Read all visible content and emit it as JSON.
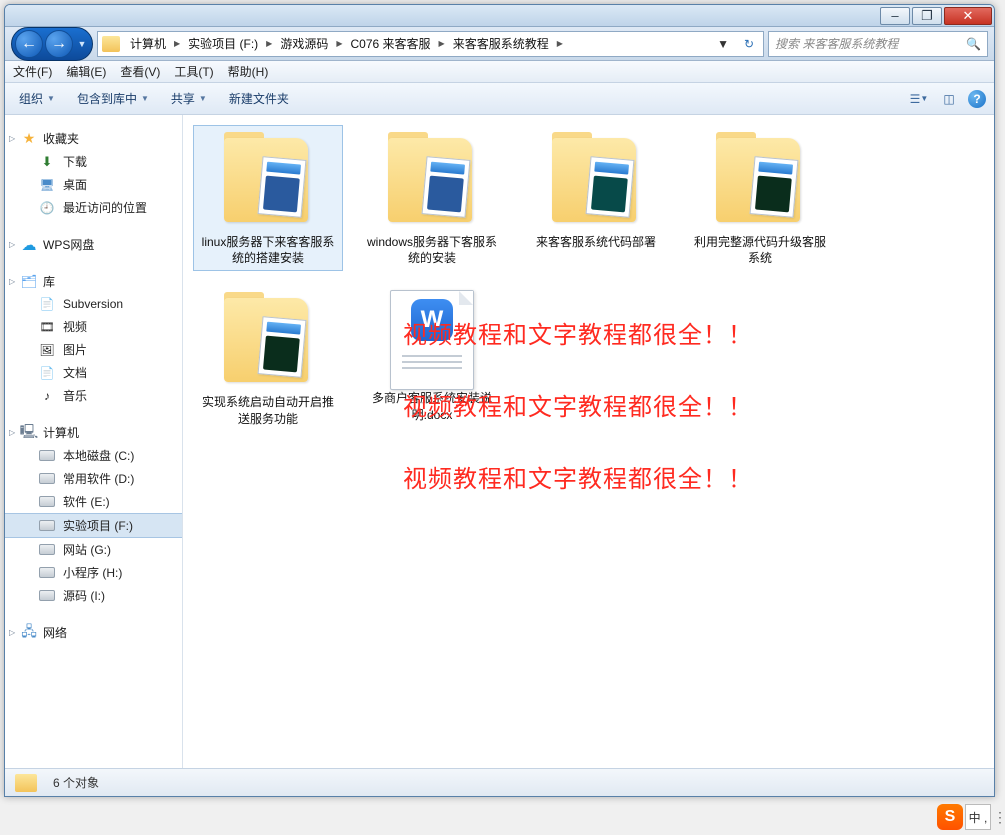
{
  "window": {
    "minimize": "–",
    "maximize": "❐",
    "close": "✕"
  },
  "breadcrumb": [
    "计算机",
    "实验项目 (F:)",
    "游戏源码",
    "C076 来客客服",
    "来客客服系统教程"
  ],
  "search_placeholder": "搜索 来客客服系统教程",
  "menubar": [
    "文件(F)",
    "编辑(E)",
    "查看(V)",
    "工具(T)",
    "帮助(H)"
  ],
  "toolbar": {
    "organize": "组织",
    "include": "包含到库中",
    "share": "共享",
    "newfolder": "新建文件夹"
  },
  "sidebar": {
    "favorites": {
      "title": "收藏夹",
      "items": [
        "下载",
        "桌面",
        "最近访问的位置"
      ]
    },
    "wps": "WPS网盘",
    "library": {
      "title": "库",
      "items": [
        "Subversion",
        "视频",
        "图片",
        "文档",
        "音乐"
      ]
    },
    "computer": {
      "title": "计算机",
      "items": [
        "本地磁盘 (C:)",
        "常用软件 (D:)",
        "软件 (E:)",
        "实验项目 (F:)",
        "网站 (G:)",
        "小程序 (H:)",
        "源码 (I:)"
      ],
      "active_index": 3
    },
    "network": "网络"
  },
  "items": [
    {
      "name": "linux服务器下来客客服系统的搭建安装",
      "type": "folder",
      "shot": "blue",
      "selected": true
    },
    {
      "name": "windows服务器下客服系统的安装",
      "type": "folder",
      "shot": "blue"
    },
    {
      "name": "来客客服系统代码部署",
      "type": "folder",
      "shot": "teal"
    },
    {
      "name": "利用完整源代码升级客服系统",
      "type": "folder",
      "shot": "dark"
    },
    {
      "name": "实现系统启动自动开启推送服务功能",
      "type": "folder",
      "shot": "dark"
    },
    {
      "name": "多商户客服系统安装说明.docx",
      "type": "doc"
    }
  ],
  "overlay_text": "视频教程和文字教程都很全！！",
  "status": {
    "count": "6 个对象"
  },
  "ime": {
    "logo": "S",
    "lang": "中 ,"
  }
}
